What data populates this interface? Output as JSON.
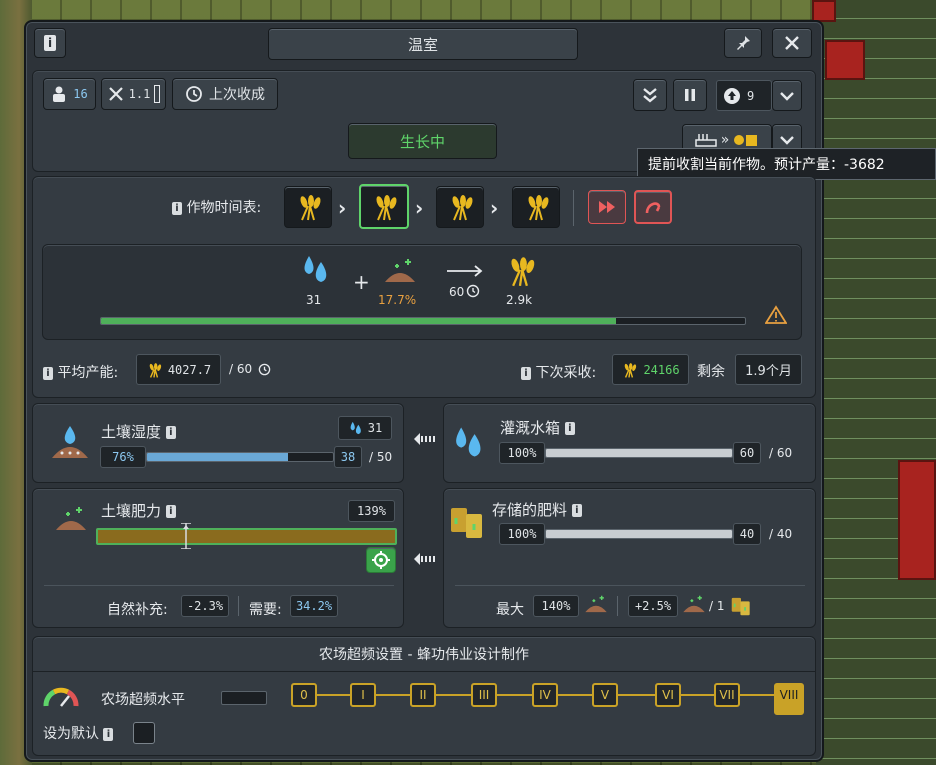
{
  "window": {
    "title": "温室"
  },
  "header": {
    "workers_count": "16",
    "tools_value": "1.1",
    "last_harvest_label": "上次收成",
    "status_label": "生长中",
    "priority_value": "9"
  },
  "tooltip": {
    "text": "提前收割当前作物。预计产量：-3682"
  },
  "schedule": {
    "label": "作物时间表:"
  },
  "recipe": {
    "water": "31",
    "fertility": "17.7%",
    "duration": "60",
    "yield": "2.9k",
    "progress": 0.8
  },
  "stats": {
    "avg_output_label": "平均产能:",
    "avg_output_value": "4027.7",
    "avg_output_per": "/ 60",
    "next_harvest_label": "下次采收:",
    "next_harvest_value": "24166",
    "remaining_label": "剩余",
    "remaining_value": "1.9个月"
  },
  "moisture": {
    "title": "土壤湿度",
    "badge": "31",
    "percent": "76%",
    "value": "38",
    "max": "/ 50",
    "fill": 0.76
  },
  "irrigation": {
    "title": "灌溉水箱",
    "percent": "100%",
    "value": "60",
    "max": "/ 60",
    "fill": 1.0
  },
  "fertility": {
    "title": "土壤肥力",
    "value": "139%",
    "fill": 1.0,
    "natural_label": "自然补充:",
    "natural_value": "-2.3%",
    "need_label": "需要:",
    "need_value": "34.2%"
  },
  "storage": {
    "title": "存储的肥料",
    "percent": "100%",
    "value": "40",
    "max": "/ 40",
    "fill": 1.0,
    "max_label": "最大",
    "max_value": "140%",
    "rate_value": "+2.5%",
    "rate_per": "/ 1"
  },
  "overclock": {
    "section_title": "农场超频设置 - 蜂功伟业设计制作",
    "level_label": "农场超频水平",
    "default_label": "设为默认",
    "tiers": [
      "0",
      "I",
      "II",
      "III",
      "IV",
      "V",
      "VI",
      "VII",
      "VIII"
    ]
  },
  "colors": {
    "accent_gold": "#c9a227",
    "green_status": "#5fd46a",
    "water_blue": "#5ab8ef",
    "red_button": "#e05555"
  }
}
